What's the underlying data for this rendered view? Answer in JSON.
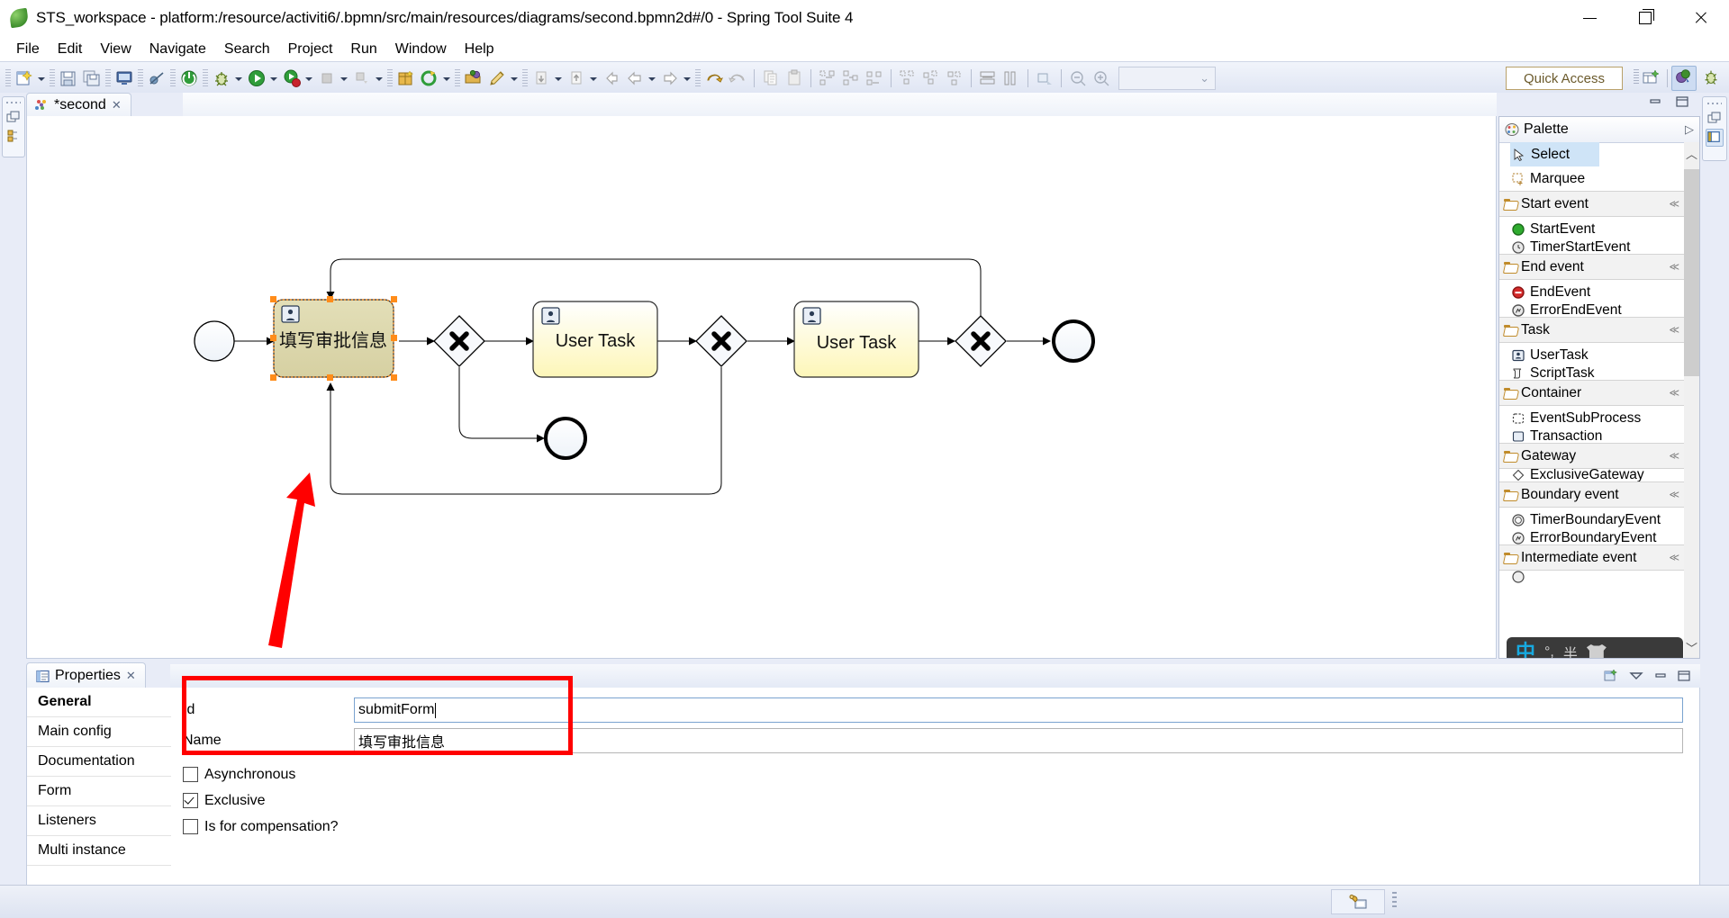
{
  "window": {
    "title": "STS_workspace - platform:/resource/activiti6/.bpmn/src/main/resources/diagrams/second.bpmn2d#/0 - Spring Tool Suite 4",
    "app_icon": "spring-leaf-icon",
    "minimize": "minimize-icon",
    "maximize": "restore-icon",
    "close": "close-icon"
  },
  "menubar": {
    "items": [
      "File",
      "Edit",
      "View",
      "Navigate",
      "Search",
      "Project",
      "Run",
      "Window",
      "Help"
    ]
  },
  "toolbar": {
    "quick_access": "Quick Access",
    "icons": [
      "new-wizard-icon",
      "save-icon",
      "save-all-icon",
      "console-icon",
      "skip-breakpoints-icon",
      "terminate-icon",
      "debug-icon",
      "run-icon",
      "run-boot-icon",
      "stop-icon",
      "step-icon",
      "new-package-icon",
      "refresh-icon",
      "open-type-icon",
      "edit-icon",
      "next-annotation-icon",
      "previous-annotation-icon",
      "back-icon",
      "forward-left-icon",
      "forward-right-icon",
      "undo-icon",
      "redo-icon",
      "copy-icon",
      "paste-icon",
      "align-left-icon",
      "align-center-icon",
      "align-right-icon",
      "align-top-icon",
      "align-middle-icon",
      "align-bottom-icon",
      "match-height-icon",
      "match-width-icon",
      "export-icon",
      "zoom-out-icon",
      "zoom-in-icon"
    ],
    "zoom_value": "",
    "perspective_new": "open-perspective-icon",
    "perspective_spring": "spring-perspective-icon",
    "perspective_debug": "debug-perspective-icon"
  },
  "editor": {
    "tab_label": "*second",
    "tab_icon": "bpmn-diagram-icon",
    "tab_close": "close-tab-icon",
    "minimize": "minimize-view-icon",
    "maximize": "maximize-view-icon"
  },
  "diagram": {
    "nodes": [
      {
        "id": "startEvent",
        "type": "start-event",
        "label": ""
      },
      {
        "id": "submitForm",
        "type": "user-task",
        "label": "填写审批信息",
        "selected": true
      },
      {
        "id": "gw1",
        "type": "exclusive-gateway",
        "label": ""
      },
      {
        "id": "userTask1",
        "type": "user-task",
        "label": "User Task"
      },
      {
        "id": "gw2",
        "type": "exclusive-gateway",
        "label": ""
      },
      {
        "id": "userTask2",
        "type": "user-task",
        "label": "User Task"
      },
      {
        "id": "gw3",
        "type": "exclusive-gateway",
        "label": ""
      },
      {
        "id": "endEvent1",
        "type": "end-event",
        "label": ""
      },
      {
        "id": "endEvent2",
        "type": "end-event",
        "label": ""
      }
    ],
    "selection_handles_color": "#ff8c1a",
    "task_fill": "#fffde0",
    "selected_task_fill": "#ded9b0",
    "annotation_arrow_color": "#ff0000"
  },
  "palette": {
    "title": "Palette",
    "title_icon": "palette-icon",
    "collapse_icon": "chevron-right-icon",
    "scroll_up_icon": "chevron-up-icon",
    "scroll_down_icon": "chevron-down-icon",
    "tools": [
      {
        "label": "Select",
        "icon": "cursor-icon",
        "selected": true
      },
      {
        "label": "Marquee",
        "icon": "marquee-icon",
        "selected": false
      }
    ],
    "groups": [
      {
        "name": "Start event",
        "icon": "folder-icon",
        "pin": "pin-icon",
        "entries": [
          {
            "label": "StartEvent",
            "icon": "start-event-icon"
          },
          {
            "label": "TimerStartEvent",
            "icon": "timer-start-event-icon",
            "clipped": true
          }
        ]
      },
      {
        "name": "End event",
        "icon": "folder-icon",
        "pin": "pin-icon",
        "entries": [
          {
            "label": "EndEvent",
            "icon": "end-event-icon"
          },
          {
            "label": "ErrorEndEvent",
            "icon": "error-end-event-icon",
            "clipped": true
          }
        ]
      },
      {
        "name": "Task",
        "icon": "folder-icon",
        "pin": "pin-icon",
        "entries": [
          {
            "label": "UserTask",
            "icon": "user-task-icon"
          },
          {
            "label": "ScriptTask",
            "icon": "script-task-icon",
            "clipped": true
          }
        ]
      },
      {
        "name": "Container",
        "icon": "folder-icon",
        "pin": "pin-icon",
        "entries": [
          {
            "label": "EventSubProcess",
            "icon": "event-subprocess-icon"
          },
          {
            "label": "Transaction",
            "icon": "transaction-icon",
            "clipped": true
          }
        ]
      },
      {
        "name": "Gateway",
        "icon": "folder-icon",
        "pin": "pin-icon",
        "entries": [
          {
            "label": "ExclusiveGateway",
            "icon": "exclusive-gateway-icon",
            "clipped": true
          }
        ]
      },
      {
        "name": "Boundary event",
        "icon": "folder-icon",
        "pin": "pin-icon",
        "entries": [
          {
            "label": "TimerBoundaryEvent",
            "icon": "timer-boundary-event-icon"
          },
          {
            "label": "ErrorBoundaryEvent",
            "icon": "error-boundary-event-icon",
            "clipped": true
          }
        ]
      },
      {
        "name": "Intermediate event",
        "icon": "folder-icon",
        "pin": "pin-icon",
        "entries": []
      }
    ]
  },
  "ime": {
    "mode_label": "中",
    "punct_label": "°,",
    "halfwidth_label": "半",
    "skin_icon": "shirt-icon"
  },
  "properties": {
    "tab_label": "Properties",
    "tab_icon": "properties-icon",
    "tab_close": "close-tab-icon",
    "toolbar_icons": [
      "new-view-icon",
      "view-menu-icon",
      "minimize-view-icon",
      "maximize-view-icon"
    ],
    "sections": [
      {
        "label": "General",
        "active": true
      },
      {
        "label": "Main config",
        "active": false
      },
      {
        "label": "Documentation",
        "active": false
      },
      {
        "label": "Form",
        "active": false
      },
      {
        "label": "Listeners",
        "active": false
      },
      {
        "label": "Multi instance",
        "active": false
      }
    ],
    "fields": [
      {
        "label": "Id",
        "value": "submitForm",
        "focused": true
      },
      {
        "label": "Name",
        "value": "填写审批信息",
        "focused": false
      }
    ],
    "checkboxes": [
      {
        "label": "Asynchronous",
        "checked": false
      },
      {
        "label": "Exclusive",
        "checked": true
      },
      {
        "label": "Is for compensation?",
        "checked": false
      }
    ]
  },
  "statusbar": {
    "indicator_icon": "lock-workspace-icon"
  }
}
